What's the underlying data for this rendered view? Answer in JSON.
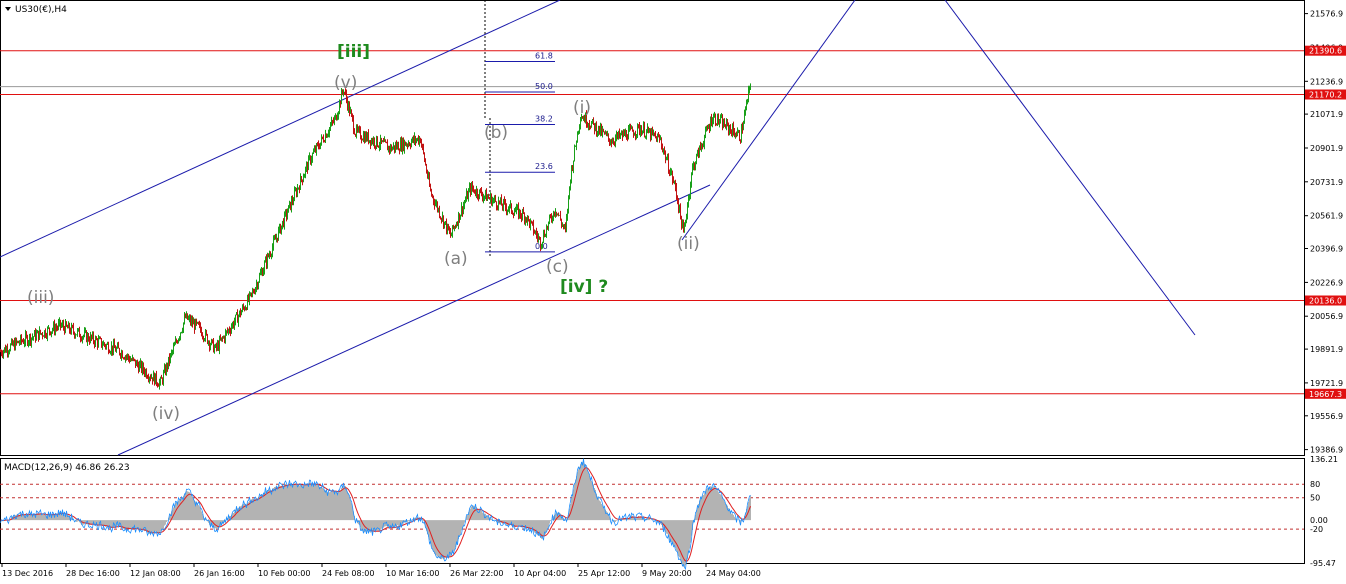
{
  "window": {
    "title": "US30(€),H4"
  },
  "colors": {
    "up": "#19a019",
    "down": "#c21313",
    "level": "#e01010",
    "trend": "#1b1bab",
    "macd_hist": "#b3b3b3",
    "macd_signal": "#e02020",
    "macd_line": "#1e90ff",
    "wave_label": "#7f7f7f",
    "wave_label_major": "#1e8a1e"
  },
  "chart_data": {
    "type": "candlestick",
    "title": "US30(€),H4",
    "y_ticks": [
      "21576.9",
      "21406.9",
      "21236.9",
      "21071.9",
      "20901.9",
      "20731.9",
      "20561.9",
      "20396.9",
      "20226.9",
      "20056.9",
      "19891.9",
      "19721.9",
      "19556.9",
      "19386.9"
    ],
    "y_tick_values": [
      21576.9,
      21406.9,
      21236.9,
      21071.9,
      20901.9,
      20731.9,
      20561.9,
      20396.9,
      20226.9,
      20056.9,
      19891.9,
      19721.9,
      19556.9,
      19386.9
    ],
    "x_ticks": [
      "13 Dec 2016",
      "28 Dec 16:00",
      "12 Jan 08:00",
      "26 Jan 16:00",
      "10 Feb 00:00",
      "24 Feb 08:00",
      "10 Mar 16:00",
      "26 Mar 22:00",
      "10 Apr 04:00",
      "25 Apr 12:00",
      "9 May 20:00",
      "24 May 04:00"
    ],
    "price_range": [
      19360,
      21640
    ],
    "bars_total": 720,
    "path_points": [
      [
        0,
        19880
      ],
      [
        20,
        19930
      ],
      [
        60,
        20010
      ],
      [
        120,
        19880
      ],
      [
        160,
        19720
      ],
      [
        185,
        20050
      ],
      [
        200,
        19990
      ],
      [
        215,
        19890
      ],
      [
        250,
        20150
      ],
      [
        280,
        20500
      ],
      [
        310,
        20850
      ],
      [
        335,
        21050
      ],
      [
        343,
        21200
      ],
      [
        355,
        20980
      ],
      [
        390,
        20900
      ],
      [
        420,
        20950
      ],
      [
        430,
        20680
      ],
      [
        450,
        20460
      ],
      [
        470,
        20700
      ],
      [
        500,
        20620
      ],
      [
        525,
        20560
      ],
      [
        540,
        20430
      ],
      [
        555,
        20600
      ],
      [
        565,
        20480
      ],
      [
        570,
        20760
      ],
      [
        580,
        21070
      ],
      [
        610,
        20940
      ],
      [
        640,
        21000
      ],
      [
        660,
        20940
      ],
      [
        675,
        20700
      ],
      [
        683,
        20470
      ],
      [
        692,
        20800
      ],
      [
        712,
        21060
      ],
      [
        740,
        20960
      ],
      [
        750,
        21220
      ]
    ],
    "levels": [
      {
        "label": "21390.6",
        "value": 21390.6
      },
      {
        "label": "21170.2",
        "value": 21170.2
      },
      {
        "label": "20136.0",
        "value": 20136.0
      },
      {
        "label": "19667.3",
        "value": 19667.3
      }
    ],
    "current_price_tag": "21209.9",
    "fibonacci": [
      {
        "label": "61.8",
        "value": 21336
      },
      {
        "label": "50.0",
        "value": 21183
      },
      {
        "label": "38.2",
        "value": 21020
      },
      {
        "label": "23.6",
        "value": 20780
      },
      {
        "label": "0.0",
        "value": 20380
      }
    ],
    "wave_labels": [
      "[iii]",
      "(v)",
      "(iii)",
      "(iv)",
      "(b)",
      "(a)",
      "(c)",
      "[iv] ?",
      "(i)",
      "(ii)"
    ],
    "macd": {
      "title": "MACD(12,26,9) 46.86 26.23",
      "y_ticks": [
        "136.21",
        "80",
        "50",
        "0.00",
        "-20",
        "-95.47"
      ],
      "y_tick_values": [
        136.21,
        80,
        50,
        0,
        -20,
        -95.47
      ],
      "range": [
        -95.47,
        136.21
      ],
      "levels": [
        80,
        50,
        -20
      ]
    }
  }
}
